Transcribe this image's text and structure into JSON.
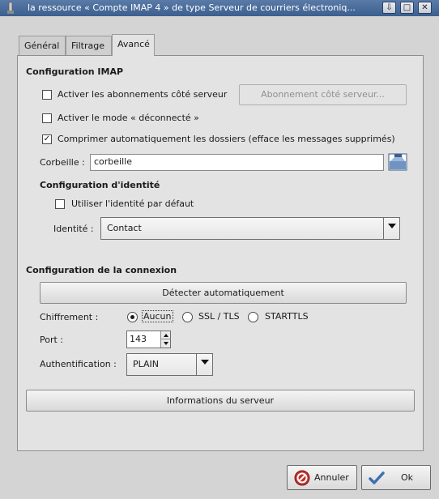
{
  "window": {
    "title": "la ressource « Compte IMAP 4 » de type Serveur de courriers électroniq...",
    "controls": {
      "restore": "⇩",
      "maximize": "□",
      "close": "✕"
    }
  },
  "tabs": [
    {
      "label": "Général",
      "active": false
    },
    {
      "label": "Filtrage",
      "active": false
    },
    {
      "label": "Avancé",
      "active": true
    }
  ],
  "imap": {
    "section_title": "Configuration IMAP",
    "subscriptions": {
      "label": "Activer les abonnements côté serveur",
      "checked": false,
      "mark": ""
    },
    "subscriptions_button": "Abonnement côté serveur...",
    "disconnected": {
      "label": "Activer le mode « déconnecté »",
      "checked": false,
      "mark": ""
    },
    "compact": {
      "label": "Comprimer automatiquement les dossiers (efface les messages supprimés)",
      "checked": true,
      "mark": "✓"
    },
    "trash_label": "Corbeille :",
    "trash_value": "corbeille"
  },
  "identity": {
    "section_title": "Configuration d'identité",
    "use_default": {
      "label": "Utiliser l'identité par défaut",
      "checked": false,
      "mark": ""
    },
    "identity_label": "Identité :",
    "identity_value": "Contact"
  },
  "connection": {
    "section_title": "Configuration de la connexion",
    "detect_button": "Détecter automatiquement",
    "encryption_label": "Chiffrement :",
    "encryption_options": [
      {
        "label": "Aucun",
        "selected": true
      },
      {
        "label": "SSL / TLS",
        "selected": false
      },
      {
        "label": "STARTTLS",
        "selected": false
      }
    ],
    "port_label": "Port :",
    "port_value": "143",
    "auth_label": "Authentification :",
    "auth_value": "PLAIN",
    "server_info_button": "Informations du serveur"
  },
  "footer": {
    "cancel_label": "Annuler",
    "ok_label": "Ok"
  },
  "colors": {
    "titlebar": "#3c5f8f",
    "cancel_icon": "#c4302b",
    "ok_icon": "#3f6fb0"
  }
}
